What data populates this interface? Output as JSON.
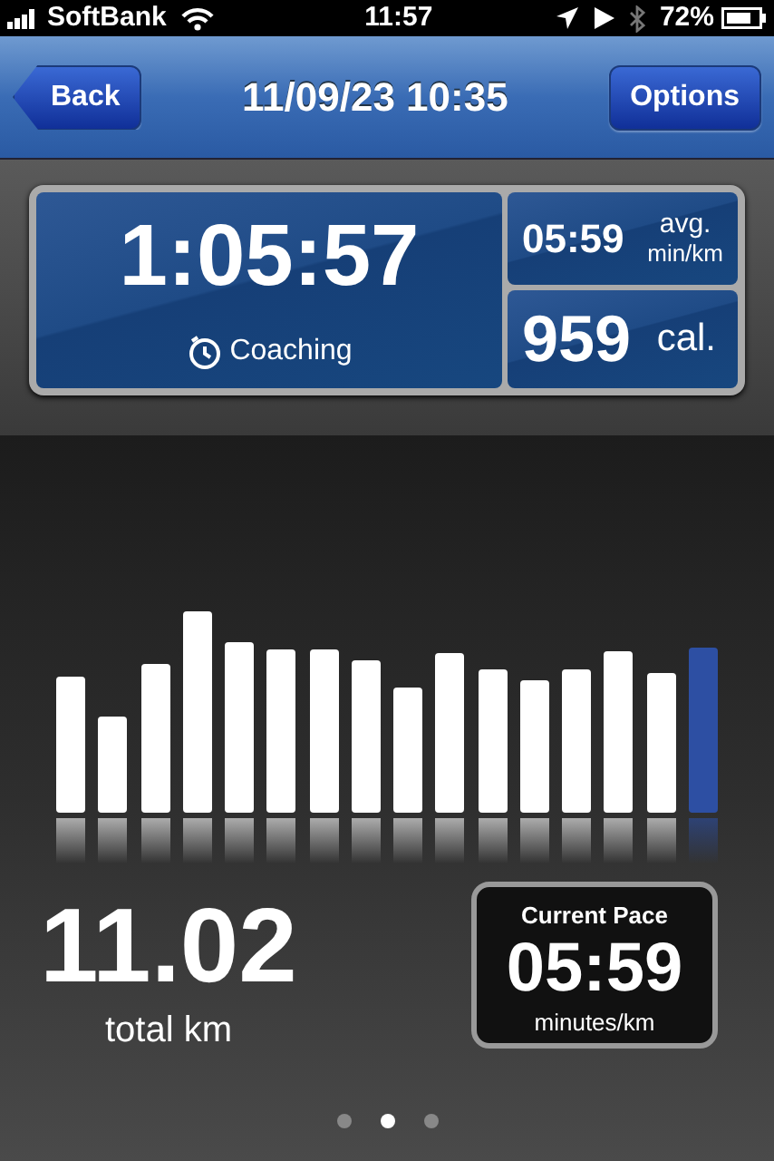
{
  "status_bar": {
    "carrier": "SoftBank",
    "time": "11:57",
    "battery": "72%"
  },
  "nav_bar": {
    "back": "Back",
    "title": "11/09/23 10:35",
    "action": "Options"
  },
  "summary": {
    "duration": "1:05:57",
    "coaching": "Coaching",
    "avg_pace": "05:59",
    "avg_label": "avg.",
    "avg_unit": "min/km",
    "calories": "959",
    "calories_unit": "cal."
  },
  "splits": [
    {
      "selected": false
    },
    {
      "selected": false
    },
    {
      "selected": false
    },
    {
      "selected": false
    },
    {
      "selected": false
    },
    {
      "selected": false
    },
    {
      "selected": false
    },
    {
      "selected": false
    },
    {
      "selected": false
    },
    {
      "selected": false
    },
    {
      "selected": false
    },
    {
      "selected": false
    },
    {
      "selected": false
    },
    {
      "selected": false
    },
    {
      "selected": false
    },
    {
      "selected": true
    }
  ],
  "distance": {
    "value": "11.02",
    "label": "total km"
  },
  "current_pace": {
    "title": "Current Pace",
    "value": "05:59",
    "unit": "minutes/km"
  },
  "pages": [
    {
      "selected": false
    },
    {
      "selected": true
    },
    {
      "selected": false
    }
  ]
}
